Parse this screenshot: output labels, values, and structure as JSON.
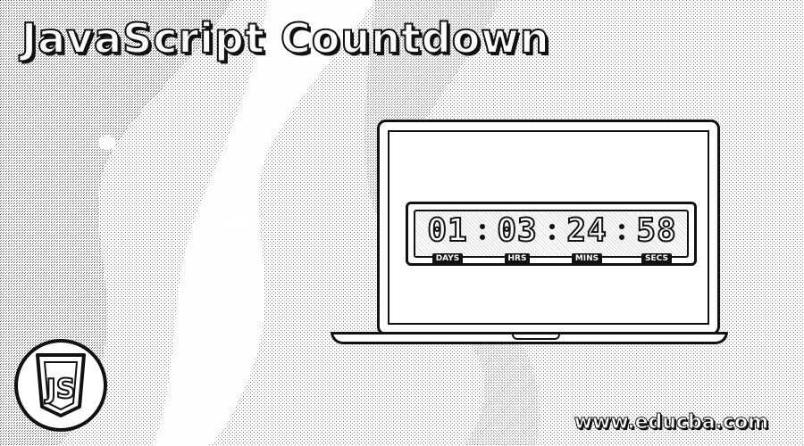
{
  "banner": {
    "title": "JavaScript Countdown",
    "watermark": "www.educba.com"
  },
  "logo": {
    "icon": "js-shield-icon",
    "text": "JS"
  },
  "countdown": {
    "days": "01",
    "hours": "03",
    "minutes": "24",
    "seconds": "58",
    "days_label": "DAYS",
    "hours_label": "HRS",
    "minutes_label": "MINS",
    "seconds_label": "SECS"
  },
  "colors": {
    "ink": "#111111",
    "paper": "#ffffff"
  }
}
